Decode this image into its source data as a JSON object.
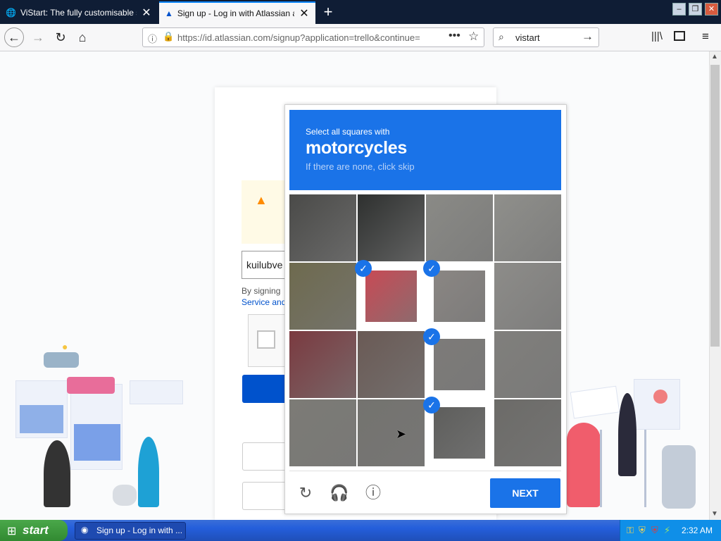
{
  "tabs": [
    {
      "title": "ViStart: The fully customisable start"
    },
    {
      "title": "Sign up - Log in with Atlassian acc"
    }
  ],
  "address": {
    "url": "https://id.atlassian.com/signup?application=trello&continue="
  },
  "search": {
    "value": "vistart"
  },
  "page": {
    "email_value": "kuilubve",
    "terms_line1": "By signing",
    "terms_line2": "Service and"
  },
  "challenge": {
    "instruction": "Select all squares with",
    "object": "motorcycles",
    "skip_hint": "If there are none, click skip",
    "tiles": [
      {
        "selected": false,
        "tone": "#4a4a48"
      },
      {
        "selected": false,
        "tone": "#2e302f"
      },
      {
        "selected": false,
        "tone": "#8a8a86"
      },
      {
        "selected": false,
        "tone": "#8f8f8b"
      },
      {
        "selected": false,
        "tone": "#6e6a4e"
      },
      {
        "selected": true,
        "tone": "#c84a55"
      },
      {
        "selected": true,
        "tone": "#8a8683"
      },
      {
        "selected": false,
        "tone": "#8d8c89"
      },
      {
        "selected": false,
        "tone": "#7b3a40"
      },
      {
        "selected": false,
        "tone": "#6a5a55"
      },
      {
        "selected": true,
        "tone": "#7d7b79"
      },
      {
        "selected": false,
        "tone": "#807f7c"
      },
      {
        "selected": false,
        "tone": "#7c7b76"
      },
      {
        "selected": false,
        "tone": "#74736f"
      },
      {
        "selected": true,
        "tone": "#5e5e5c"
      },
      {
        "selected": false,
        "tone": "#6c6b68"
      }
    ],
    "next_label": "NEXT"
  },
  "taskbar": {
    "start_label": "start",
    "task_title": "Sign up - Log in with ...",
    "clock": "2:32 AM"
  },
  "colors": {
    "accent": "#1a73e8",
    "atlassian_blue": "#0052cc"
  }
}
